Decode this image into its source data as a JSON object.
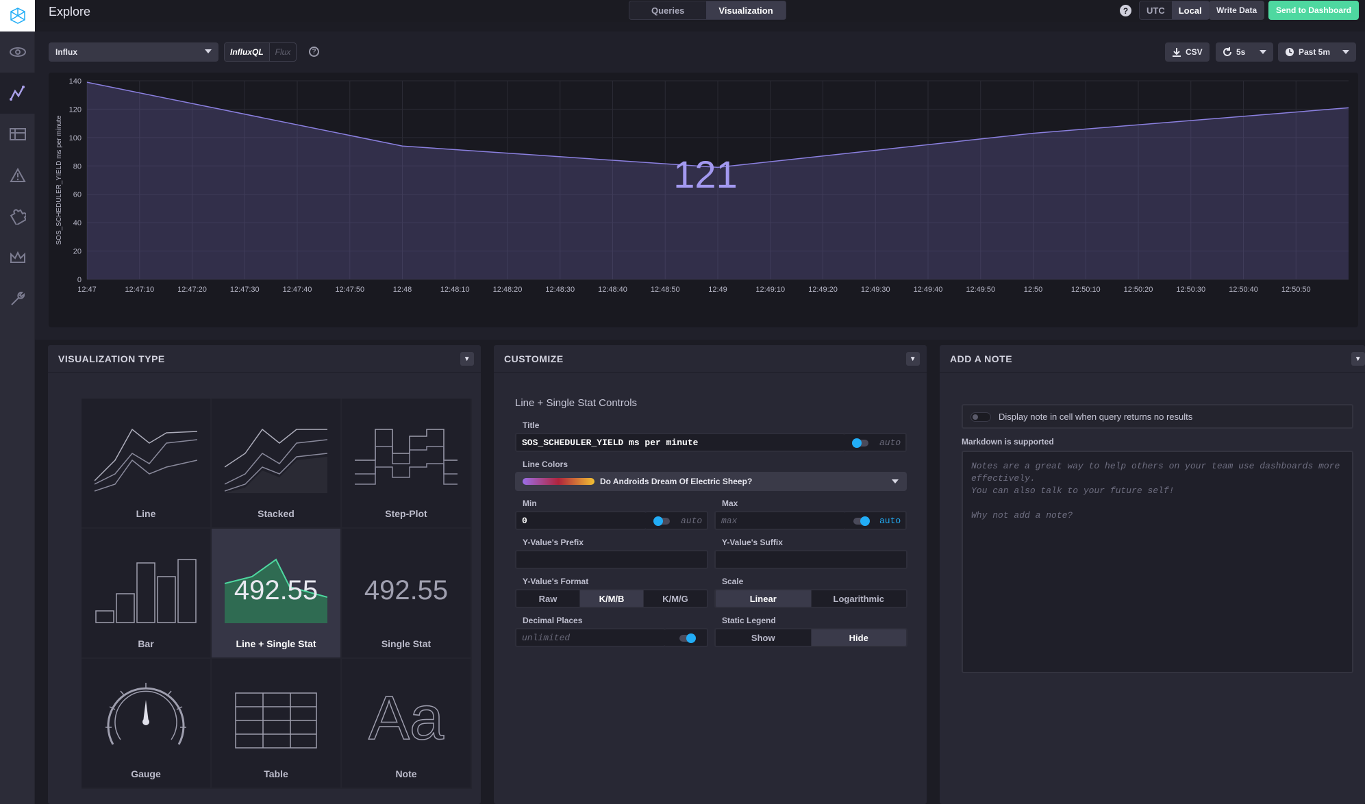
{
  "topbar": {
    "title": "Explore",
    "mode_tabs": [
      {
        "label": "Queries",
        "active": false
      },
      {
        "label": "Visualization",
        "active": true
      }
    ],
    "help": "?",
    "tz": [
      {
        "label": "UTC",
        "active": false
      },
      {
        "label": "Local",
        "active": true
      }
    ],
    "write_data": "Write Data",
    "send": "Send to Dashboard"
  },
  "sidebar": {
    "items": [
      "logo-icon",
      "eye-icon",
      "graph-icon",
      "table-icon",
      "alert-icon",
      "puzzle-icon",
      "crown-icon",
      "wrench-icon"
    ],
    "active": "graph-icon"
  },
  "query_bar": {
    "source": "Influx",
    "languages": [
      {
        "label": "InfluxQL",
        "active": true
      },
      {
        "label": "Flux",
        "active": false
      }
    ],
    "help": "?",
    "csv": "CSV",
    "refresh": "5s",
    "range": "Past 5m"
  },
  "chart_data": {
    "type": "area",
    "ylabel": "SOS_SCHEDULER_YIELD ms per minute",
    "ylim": [
      0,
      140
    ],
    "yticks": [
      0,
      20,
      40,
      60,
      80,
      100,
      120,
      140
    ],
    "x_labels": [
      "12:47",
      "12:47:10",
      "12:47:20",
      "12:47:30",
      "12:47:40",
      "12:47:50",
      "12:48",
      "12:48:10",
      "12:48:20",
      "12:48:30",
      "12:48:40",
      "12:48:50",
      "12:49",
      "12:49:10",
      "12:49:20",
      "12:49:30",
      "12:49:40",
      "12:49:50",
      "12:50",
      "12:50:10",
      "12:50:20",
      "12:50:30",
      "12:50:40",
      "12:50:50"
    ],
    "x_label_secs": [
      0,
      10,
      20,
      30,
      40,
      50,
      60,
      70,
      80,
      90,
      100,
      110,
      120,
      130,
      140,
      150,
      160,
      170,
      180,
      190,
      200,
      210,
      220,
      230
    ],
    "x_max_secs": 240,
    "x": [
      0,
      60,
      120,
      180,
      240
    ],
    "y": [
      139,
      94,
      79,
      103,
      121
    ],
    "single_stat": "121",
    "line_color": "#8b80e0"
  },
  "viz_panel": {
    "title": "VISUALIZATION TYPE",
    "types": [
      {
        "label": "Line",
        "selected": false
      },
      {
        "label": "Stacked",
        "selected": false
      },
      {
        "label": "Step-Plot",
        "selected": false
      },
      {
        "label": "Bar",
        "selected": false
      },
      {
        "label": "Line + Single Stat",
        "selected": true,
        "stat": "492.55"
      },
      {
        "label": "Single Stat",
        "selected": false,
        "stat": "492.55"
      },
      {
        "label": "Gauge",
        "selected": false
      },
      {
        "label": "Table",
        "selected": false
      },
      {
        "label": "Note",
        "selected": false,
        "glyph": "Aa"
      }
    ]
  },
  "customize": {
    "title": "CUSTOMIZE",
    "heading": "Line + Single Stat Controls",
    "title_label": "Title",
    "title_value": "SOS_SCHEDULER_YIELD ms per minute",
    "title_auto": "auto",
    "line_colors_label": "Line Colors",
    "line_colors_value": "Do Androids Dream Of Electric Sheep?",
    "min_label": "Min",
    "min_value": "0",
    "min_auto": "auto",
    "max_label": "Max",
    "max_placeholder": "max",
    "max_auto": "auto",
    "prefix_label": "Y-Value's Prefix",
    "suffix_label": "Y-Value's Suffix",
    "format_label": "Y-Value's Format",
    "formats": [
      {
        "label": "Raw",
        "active": false
      },
      {
        "label": "K/M/B",
        "active": true
      },
      {
        "label": "K/M/G",
        "active": false
      }
    ],
    "scale_label": "Scale",
    "scales": [
      {
        "label": "Linear",
        "active": true
      },
      {
        "label": "Logarithmic",
        "active": false
      }
    ],
    "decimal_label": "Decimal Places",
    "decimal_placeholder": "unlimited",
    "legend_label": "Static Legend",
    "legend": [
      {
        "label": "Show",
        "active": false
      },
      {
        "label": "Hide",
        "active": true
      }
    ]
  },
  "note": {
    "title": "ADD A NOTE",
    "toggle_label": "Display note in cell when query returns no results",
    "markdown": "Markdown is supported",
    "placeholder": "Notes are a great way to help others on your team use dashboards more effectively.\nYou can also talk to your future self!\n\nWhy not add a note?"
  },
  "colors": {
    "accent": "#22adf6",
    "send": "#4ed8a0",
    "line": "#8b80e0"
  }
}
